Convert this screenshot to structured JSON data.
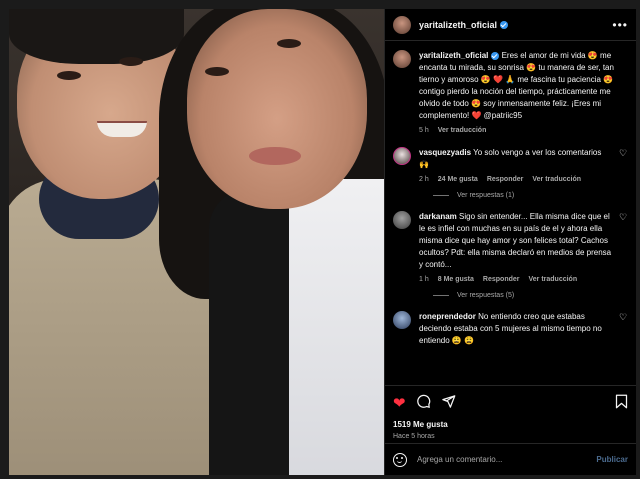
{
  "post": {
    "username": "yaritalizeth_oficial",
    "more_icon": "more-horizontal-icon",
    "caption": "Eres el amor de mi vida 😍 me encanta tu mirada, su sonrisa 😍 tu manera de ser, tan tierno y amoroso 😍 ❤️ 🙏 me fascina tu paciencia 😍 contigo pierdo la noción del tiempo, prácticamente me olvido de todo 😍 soy inmensamente feliz. ¡Eres mi complemento! ❤️ @patriic95",
    "caption_time": "5 h",
    "caption_translate": "Ver traducción"
  },
  "comments": [
    {
      "username": "vasquezyadis",
      "text": "Yo solo vengo a ver los comentarios 🙌",
      "time": "2 h",
      "likes": "24 Me gusta",
      "reply": "Responder",
      "translate": "Ver traducción",
      "view_replies": "Ver respuestas (1)"
    },
    {
      "username": "darkanam",
      "text": "Sigo sin entender... Ella misma dice que el le es infiel con muchas en su país de el y ahora ella misma dice que hay amor y son felices total? Cachos ocultos? Pdt: ella misma declaró en medios de prensa y contó...",
      "time": "1 h",
      "likes": "8 Me gusta",
      "reply": "Responder",
      "translate": "Ver traducción",
      "view_replies": "Ver respuestas (5)"
    },
    {
      "username": "roneprendedor",
      "text": "No entiendo creo que estabas deciendo estaba con 5 mujeres al mismo tiempo no entiendo 😩 😩"
    }
  ],
  "actions": {
    "like_icon": "heart-filled-icon",
    "comment_icon": "comment-icon",
    "share_icon": "send-icon",
    "save_icon": "bookmark-icon",
    "likes_count": "1519 Me gusta",
    "posted_time": "Hace 5 horas"
  },
  "add_comment": {
    "placeholder": "Agrega un comentario...",
    "publish_label": "Publicar",
    "emoji_icon": "emoji-icon"
  },
  "colors": {
    "background": "#000000",
    "overlay": "#1b1b1b",
    "verified": "#3897f0",
    "liked_heart": "#ff3040",
    "secondary_text": "#a8a8a8"
  }
}
